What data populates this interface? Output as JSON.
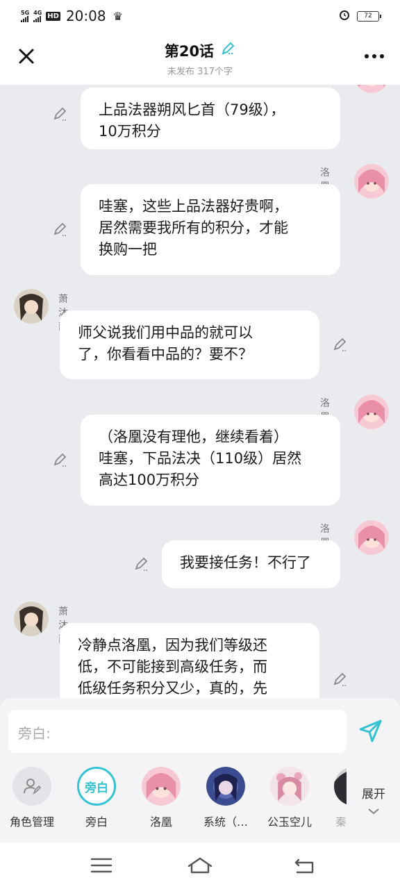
{
  "status_bar": {
    "net1": "5G",
    "net2": "4G",
    "hd": "HD",
    "time": "20:08",
    "battery": "72"
  },
  "header": {
    "title": "第20话",
    "subtitle": "未发布 317个字"
  },
  "messages": [
    {
      "speaker": "",
      "side": "right",
      "lines": [
        "上品法器朔风匕首（79级），",
        "10万积分"
      ]
    },
    {
      "speaker": "洛凰",
      "side": "right",
      "lines": [
        "哇塞，这些上品法器好贵啊，",
        "居然需要我所有的积分，才能",
        "换购一把"
      ]
    },
    {
      "speaker": "萧沐雨",
      "side": "left",
      "lines": [
        "师父说我们用中品的就可以",
        "了，你看看中品的？要不？"
      ]
    },
    {
      "speaker": "洛凰",
      "side": "right",
      "lines": [
        "（洛凰没有理他，继续看着）",
        "哇塞，下品法决（110级）居然",
        "高达100万积分"
      ]
    },
    {
      "speaker": "洛凰",
      "side": "right",
      "lines": [
        "我要接任务！不行了"
      ]
    },
    {
      "speaker": "萧沐雨",
      "side": "left",
      "lines": [
        "冷静点洛凰，因为我们等级还",
        "低，不可能接到高级任务，而",
        "低级任务积分又少，真的，先"
      ]
    }
  ],
  "input": {
    "placeholder": "旁白:"
  },
  "roles": [
    {
      "label": "角色管理"
    },
    {
      "label": "旁白",
      "badge": "旁白"
    },
    {
      "label": "洛凰"
    },
    {
      "label": "系统（…"
    },
    {
      "label": "公玉空儿"
    },
    {
      "label": "秦"
    }
  ],
  "expand_label": "展开",
  "colors": {
    "accent": "#35c3d3",
    "background": "#eaebef",
    "bubble": "#ffffff"
  }
}
